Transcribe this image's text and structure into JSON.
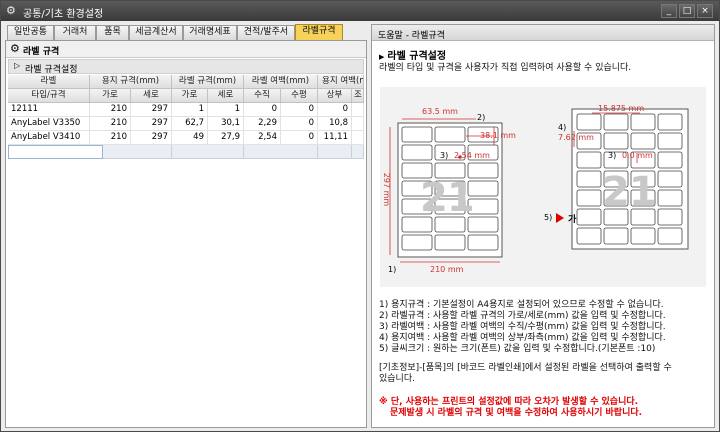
{
  "window": {
    "title": "공통/기초 환경설정",
    "minimize": "_",
    "maximize": "□",
    "close": "×"
  },
  "tabs": [
    "일반공통",
    "거래처",
    "품목",
    "세금계산서",
    "거래명세표",
    "견적/발주서",
    "라벨규격"
  ],
  "left": {
    "section_title": "라벨 규격",
    "subsection_title": "라벨 규격설정",
    "grid": {
      "group_headers": [
        "라벨",
        "용지 규격(mm)",
        "라벨 규격(mm)",
        "라벨 여백(mm)",
        "용지 여백(m"
      ],
      "sub_headers": [
        "타입/규격",
        "가로",
        "세로",
        "가로",
        "세로",
        "수직",
        "수평",
        "상부",
        "조"
      ],
      "rows": [
        [
          "12111",
          "210",
          "297",
          "1",
          "1",
          "0",
          "0",
          "0",
          ""
        ],
        [
          "AnyLabel V3350",
          "210",
          "297",
          "62,7",
          "30,1",
          "2,29",
          "0",
          "10,8",
          ""
        ],
        [
          "AnyLabel V3410",
          "210",
          "297",
          "49",
          "27,9",
          "2,54",
          "0",
          "11,11",
          ""
        ]
      ]
    }
  },
  "right": {
    "header": "도움말 - 라벨규격",
    "title": "라벨 규격설정",
    "bullet": "▶",
    "intro": "라벨의 타입 및 규격을 사용자가 직접 입력하여 사용할 수 있습니다.",
    "figure": {
      "left": {
        "width_top": "63.5 mm",
        "height": "38.1 mm",
        "gap": "2.54 mm",
        "paper_height": "297 mm",
        "paper_width": "210 mm",
        "count": "21",
        "marker1": "1)",
        "marker2": "2)",
        "marker3": "3)"
      },
      "right": {
        "top_margin": "15.875 mm",
        "left_margin": "7.62 mm",
        "gap": "0.0 mm",
        "count": "21",
        "marker3": "3)",
        "marker4": "4)",
        "marker5": "5)",
        "font_sample": "가"
      }
    },
    "notes": [
      "1) 용지규격 : 기본설정이 A4용지로 설정되어 있으므로 수정할 수 없습니다.",
      "2) 라벨규격 : 사용할 라벨 규격의 가로/세로(mm) 값을 입력 및 수정합니다.",
      "3) 라벨여백 : 사용할 라벨 여백의 수직/수평(mm) 값을 입력 및 수정합니다.",
      "4) 용지여백 : 사용할 라벨 여백의 상부/좌측(mm) 값을 입력 및 수정합니다.",
      "5) 글씨크기 : 원하는 크기(폰트) 값을 입력 및 수정합니다.(기본폰트 :10)"
    ],
    "info_line1": "[기초정보]-[품목]의 [바코드 라벨인쇄]에서 설정된 라벨을 선택하여 출력할 수",
    "info_line2": "있습니다.",
    "warn_line1": "※ 단, 사용하는 프린트의 설정값에 따라 오차가 발생할 수 있습니다.",
    "warn_line2": "문제발생 시 라벨의 규격 및 여백을 수정하여 사용하시기 바랍니다.",
    "accent": "#e00000"
  }
}
